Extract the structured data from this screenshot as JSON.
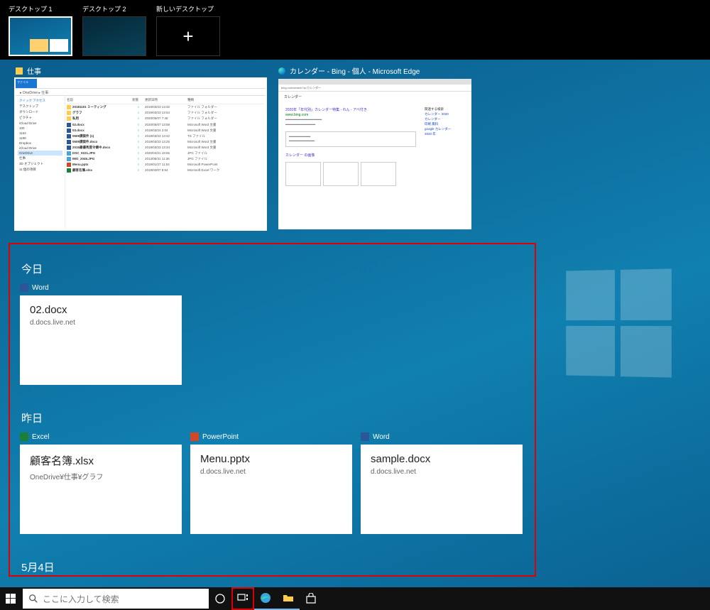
{
  "virtual_desktops": {
    "d1": "デスクトップ 1",
    "d2": "デスクトップ 2",
    "new": "新しいデスクトップ"
  },
  "open_windows": {
    "w1": {
      "title": "仕事"
    },
    "w2": {
      "title": "カレンダー - Bing - 個人 - Microsoft Edge"
    }
  },
  "explorer": {
    "tab": "ファイル",
    "address": "▸ OneDrive ▸ 仕事",
    "side": {
      "quick": "クイック アクセス",
      "desk": "デスクトップ",
      "down": "ダウンロード",
      "pic": "ピクチャ",
      "icloud": "iCloud Drive",
      "n100": "100",
      "n1163": "1163",
      "n1158": "1158",
      "dropbox": "Dropbox",
      "clouddrive": "iCloud Drive",
      "onedrive": "OneDrive",
      "work": "仕事",
      "threeD": "3D オブジェクト",
      "count": "11 個の項目"
    },
    "hdr": {
      "c1": "名前",
      "c2": "状態",
      "c3": "更新日時",
      "c4": "種類"
    },
    "rows": [
      {
        "n": "20181101 ミーティング",
        "s": "○",
        "d": "2019/03/23 13:32",
        "t": "ファイル フォルダー"
      },
      {
        "n": "グラフ",
        "s": "○",
        "d": "2019/03/23 13:54",
        "t": "ファイル フォルダー"
      },
      {
        "n": "私用",
        "s": "○",
        "d": "2020/05/07 7:46",
        "t": "ファイル フォルダー"
      },
      {
        "n": "02.docx",
        "s": "○",
        "d": "2020/05/07 13:58",
        "t": "Microsoft Word 文書"
      },
      {
        "n": "03.docx",
        "s": "○",
        "d": "2019/03/24 2:04",
        "t": "Microsoft Word 文書"
      },
      {
        "n": "0509課案件 (1)",
        "s": "○",
        "d": "2019/03/23 13:42",
        "t": "TS ファイル"
      },
      {
        "n": "0509課案件.docx",
        "s": "○",
        "d": "2019/03/23 13:25",
        "t": "Microsoft Word 文書"
      },
      {
        "n": "2015最優秀賞令嬢中.docx",
        "s": "○",
        "d": "2019/03/23 13:34",
        "t": "Microsoft Word 文書"
      },
      {
        "n": "DSC_0221.JPG",
        "s": "○",
        "d": "2020/04/21 19:55",
        "t": "JPG ファイル"
      },
      {
        "n": "IMG_2045.JPG",
        "s": "○",
        "d": "2013/05/31 11:36",
        "t": "JPG ファイル"
      },
      {
        "n": "Menu.pptx",
        "s": "○",
        "d": "2019/01/27 11:04",
        "t": "Microsoft PowerPoint"
      },
      {
        "n": "顧客名簿.xlsx",
        "s": "○",
        "d": "2019/03/07 8:54",
        "t": "Microsoft Excel ワーク"
      }
    ]
  },
  "edge": {
    "addr": "bing.com/search?q=カレンダー",
    "tab": "カレンダー",
    "headline": "2020年「年代別」カレンダー特集 - れん - アベ付き",
    "green": "www.bing.com",
    "headline2": "カレンダー の画像",
    "side_h": "関連する検索",
    "side_items": [
      "カレンダー 2020",
      "カレンダー",
      "印刷 無料",
      "google カレンダー",
      "2020 年"
    ]
  },
  "timeline": {
    "today": "今日",
    "yesterday": "昨日",
    "may4": "5月4日",
    "apps": {
      "word": "Word",
      "excel": "Excel",
      "ppt": "PowerPoint"
    },
    "today_cards": {
      "c1": {
        "fn": "02.docx",
        "sub": "d.docs.live.net"
      }
    },
    "yest_cards": {
      "c1": {
        "fn": "顧客名簿.xlsx",
        "sub": "OneDrive¥仕事¥グラフ"
      },
      "c2": {
        "fn": "Menu.pptx",
        "sub": "d.docs.live.net"
      },
      "c3": {
        "fn": "sample.docx",
        "sub": "d.docs.live.net"
      }
    }
  },
  "taskbar": {
    "search_placeholder": "ここに入力して検索"
  }
}
